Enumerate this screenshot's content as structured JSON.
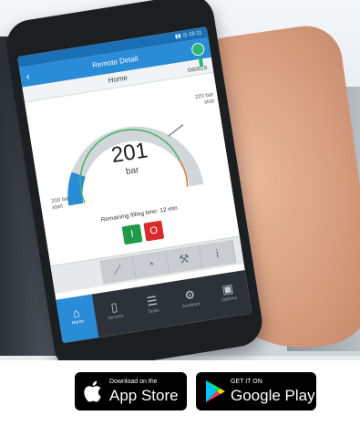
{
  "app": {
    "header_title": "Remote Detail",
    "tab_label": "Home",
    "device_code": "D6001S"
  },
  "gauge": {
    "value": "201",
    "unit": "bar",
    "start_label": "200 bar start",
    "stop_label": "220 bar stop",
    "remaining_text": "Remaining filling time: 12 min"
  },
  "controls": {
    "on_label": "I",
    "off_label": "O"
  },
  "toolbar": {
    "icons": [
      "chart-icon",
      "gauge-icon",
      "wrench-icon",
      "info-icon"
    ]
  },
  "bottom_nav": {
    "items": [
      {
        "label": "Home",
        "icon": "home-icon"
      },
      {
        "label": "Servers",
        "icon": "device-icon"
      },
      {
        "label": "Tasks",
        "icon": "tasks-icon"
      },
      {
        "label": "Analyses",
        "icon": "analysis-icon"
      },
      {
        "label": "Options",
        "icon": "options-icon"
      }
    ]
  },
  "badges": {
    "apple_small": "Download on the",
    "apple_big": "App Store",
    "google_small": "GET IT ON",
    "google_big": "Google Play"
  },
  "colors": {
    "header_blue": "#2a8bd6",
    "on_green": "#1f9a4b",
    "off_red": "#d92b2b"
  }
}
